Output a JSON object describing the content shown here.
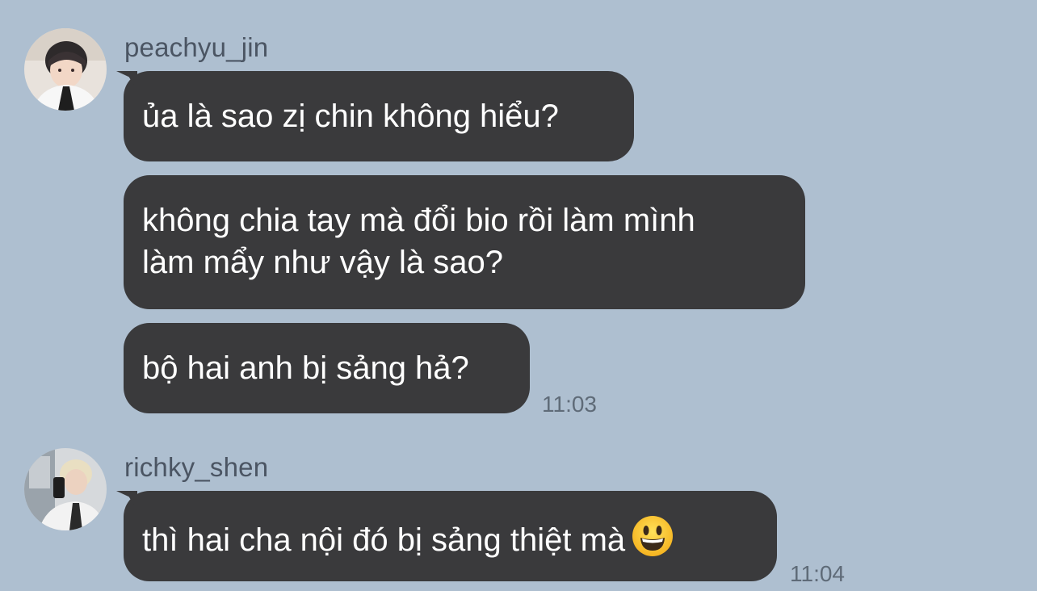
{
  "conversation": {
    "groups": [
      {
        "sender": "peachyu_jin",
        "messages": [
          {
            "lines": [
              "ủa là sao zị chin không hiểu?"
            ]
          },
          {
            "lines": [
              "không chia tay mà đổi bio rồi làm mình",
              "làm mẩy như vậy là sao?"
            ]
          },
          {
            "lines": [
              "bộ hai anh bị sảng hả?"
            ]
          }
        ],
        "time": "11:03"
      },
      {
        "sender": "richky_shen",
        "messages": [
          {
            "lines": [
              "thì hai cha nội đó bị sảng thiệt mà"
            ],
            "emoji": "grinning-face-emoji"
          }
        ],
        "time": "11:04"
      }
    ]
  },
  "colors": {
    "background": "#aebfd0",
    "bubble": "#3a3a3c",
    "bubble_text": "#ffffff",
    "meta_text": "#4b5563"
  }
}
